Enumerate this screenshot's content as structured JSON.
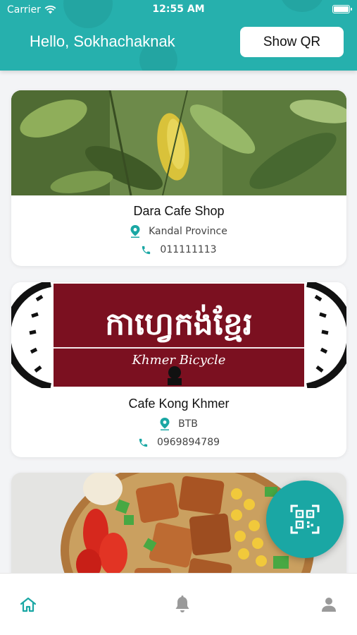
{
  "status_bar": {
    "carrier": "Carrier",
    "time": "12:55 AM"
  },
  "header": {
    "greeting": "Hello, Sokhachaknak",
    "qr_button_label": "Show QR"
  },
  "cafes": [
    {
      "name": "Dara Cafe Shop",
      "location": "Kandal Province",
      "phone": "011111113"
    },
    {
      "name": "Cafe Kong Khmer",
      "location": "BTB",
      "phone": "0969894789",
      "logo_text": "កាហ្វេកង់ខ្មែរ",
      "logo_subtitle": "Khmer Bicycle"
    },
    {
      "name": "",
      "location": "",
      "phone": ""
    }
  ],
  "tabs": [
    {
      "name": "home",
      "icon": "home-icon",
      "active": true
    },
    {
      "name": "notifications",
      "icon": "bell-icon",
      "active": false
    },
    {
      "name": "profile",
      "icon": "user-icon",
      "active": false
    }
  ],
  "colors": {
    "primary": "#26b0ad",
    "active_tab": "#1aa7a4",
    "inactive_tab": "#9a9a9a",
    "location_pin": "#1aa7a4"
  }
}
